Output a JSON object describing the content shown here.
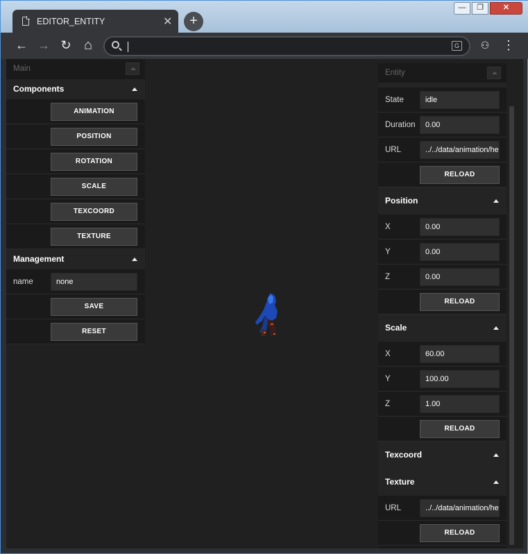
{
  "browser": {
    "tab_title": "EDITOR_ENTITY",
    "tab_close": "✕",
    "new_tab": "+",
    "address_value": "",
    "win_min": "—",
    "win_max": "❐",
    "win_close": "✕"
  },
  "nav": {
    "back": "←",
    "forward": "→",
    "reload": "↻",
    "home": "⌂",
    "menu": "⋮",
    "ext": "⚇"
  },
  "main_panel": {
    "header": "Main",
    "components": {
      "title": "Components",
      "buttons": [
        "ANIMATION",
        "POSITION",
        "ROTATION",
        "SCALE",
        "TEXCOORD",
        "TEXTURE"
      ]
    },
    "management": {
      "title": "Management",
      "name_label": "name",
      "name_value": "none",
      "save": "SAVE",
      "reset": "RESET"
    }
  },
  "entity_panel": {
    "header": "Entity",
    "animation": {
      "state_label": "State",
      "state_value": "idle",
      "duration_label": "Duration",
      "duration_value": "0.00",
      "url_label": "URL",
      "url_value": "../../data/animation/hero",
      "reload": "RELOAD"
    },
    "position": {
      "title": "Position",
      "x_label": "X",
      "x_value": "0.00",
      "y_label": "Y",
      "y_value": "0.00",
      "z_label": "Z",
      "z_value": "0.00",
      "reload": "RELOAD"
    },
    "scale": {
      "title": "Scale",
      "x_label": "X",
      "x_value": "60.00",
      "y_label": "Y",
      "y_value": "100.00",
      "z_label": "Z",
      "z_value": "1.00",
      "reload": "RELOAD"
    },
    "texcoord": {
      "title": "Texcoord"
    },
    "texture": {
      "title": "Texture",
      "url_label": "URL",
      "url_value": "../../data/animation/hero",
      "reload": "RELOAD"
    }
  },
  "colors": {
    "panel": "#1a1a1a",
    "viewport": "#202020",
    "chrome": "#35363a"
  }
}
